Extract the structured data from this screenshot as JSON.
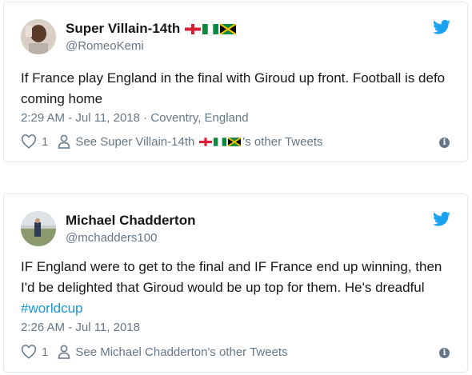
{
  "tweets": [
    {
      "name": "Super Villain-14th",
      "handle": "@RomeoKemi",
      "text": "If France play England in the final with Giroud up front. Football is defo coming home",
      "meta": "2:29 AM - Jul 11, 2018 · Coventry, England",
      "likes": "1",
      "see_other_prefix": "See Super Villain-14th",
      "see_other_suffix": "'s other Tweets",
      "flags": [
        "england-flag",
        "nigeria-flag",
        "jamaica-flag"
      ]
    },
    {
      "name": "Michael Chadderton",
      "handle": "@mchadders100",
      "text_main": "IF England were to get to the final and IF France end up winning, then I'd be delighted that Giroud would be up top for them. He's dreadful ",
      "hashtag": "#worldcup",
      "meta": "2:26 AM - Jul 11, 2018",
      "likes": "1",
      "see_other": "See Michael Chadderton's other Tweets"
    }
  ],
  "colors": {
    "text": "#14171a",
    "secondary": "#657786",
    "link": "#1b95e0",
    "twitter_blue": "#1da1f2",
    "border": "#e1e8ed"
  },
  "icons": [
    "twitter-bird-icon",
    "heart-icon",
    "person-icon",
    "info-icon"
  ]
}
